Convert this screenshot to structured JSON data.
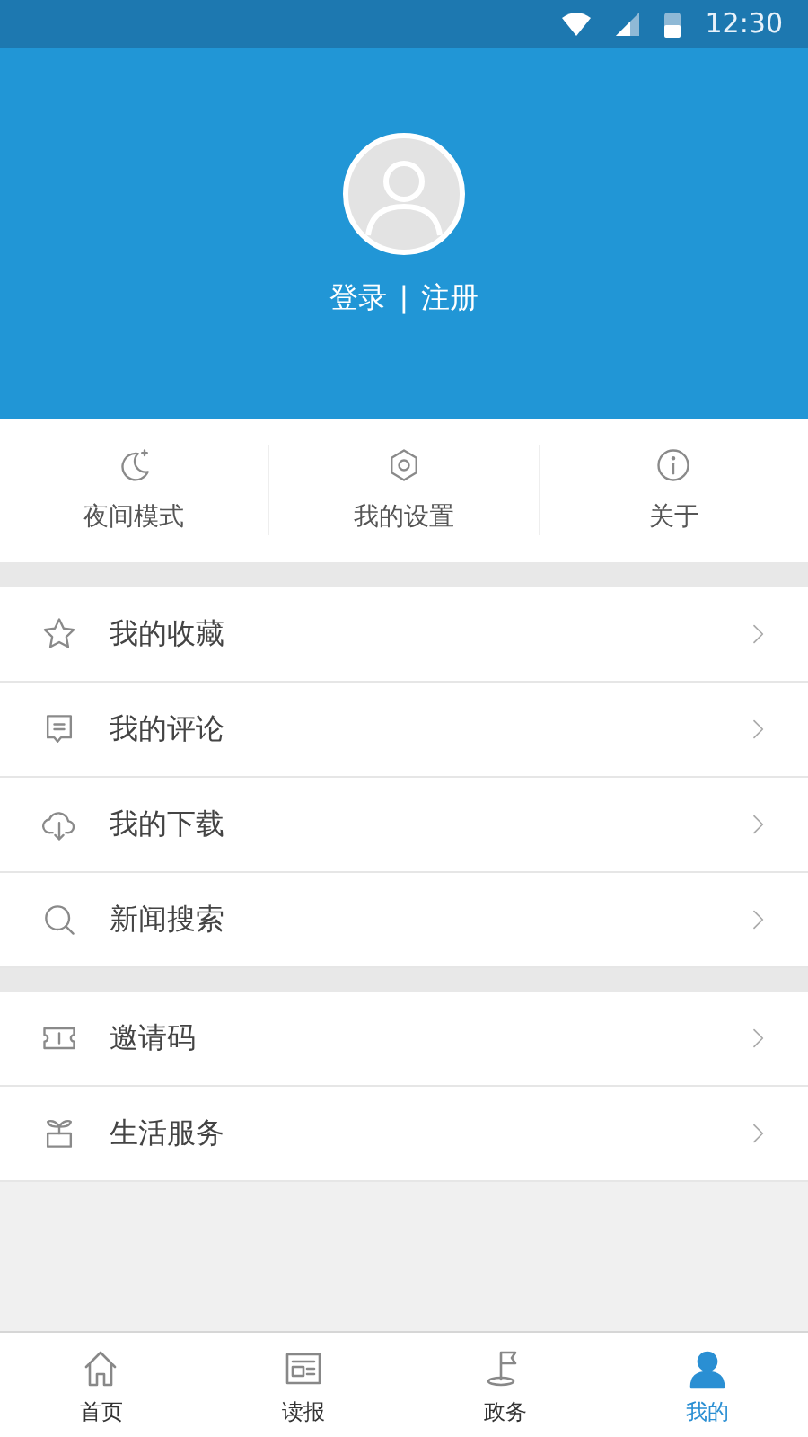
{
  "status_bar": {
    "time": "12:30"
  },
  "profile": {
    "login": "登录",
    "separator": "|",
    "register": "注册"
  },
  "quick_actions": [
    {
      "label": "夜间模式"
    },
    {
      "label": "我的设置"
    },
    {
      "label": "关于"
    }
  ],
  "menu_groups": [
    {
      "items": [
        {
          "label": "我的收藏"
        },
        {
          "label": "我的评论"
        },
        {
          "label": "我的下载"
        },
        {
          "label": "新闻搜索"
        }
      ]
    },
    {
      "items": [
        {
          "label": "邀请码"
        },
        {
          "label": "生活服务"
        }
      ]
    }
  ],
  "tab_bar": [
    {
      "label": "首页",
      "selected": false
    },
    {
      "label": "读报",
      "selected": false
    },
    {
      "label": "政务",
      "selected": false
    },
    {
      "label": "我的",
      "selected": true
    }
  ]
}
